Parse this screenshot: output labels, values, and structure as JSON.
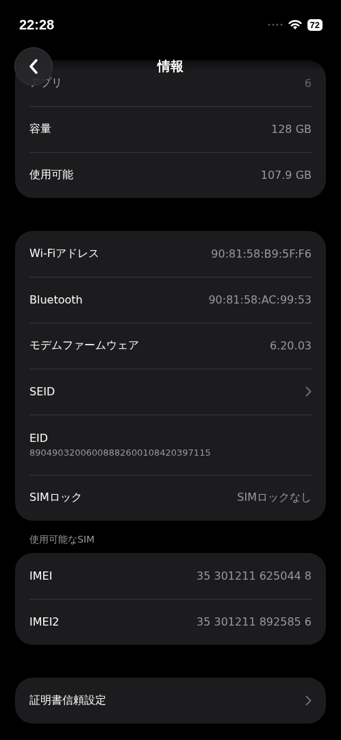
{
  "status_bar": {
    "time": "22:28",
    "battery": "72"
  },
  "nav": {
    "title": "情報"
  },
  "groups": [
    {
      "rows": [
        {
          "kind": "value",
          "label": "アプリ",
          "value": "6",
          "dimmed": true
        },
        {
          "kind": "value",
          "label": "容量",
          "value": "128 GB",
          "dimmed": false
        },
        {
          "kind": "value",
          "label": "使用可能",
          "value": "107.9 GB",
          "dimmed": false
        }
      ]
    },
    {
      "rows": [
        {
          "kind": "value",
          "label": "Wi-Fiアドレス",
          "value": "90:81:58:B9:5F:F6",
          "dimmed": false
        },
        {
          "kind": "value",
          "label": "Bluetooth",
          "value": "90:81:58:AC:99:53",
          "dimmed": false
        },
        {
          "kind": "value",
          "label": "モデムファームウェア",
          "value": "6.20.03",
          "dimmed": false
        },
        {
          "kind": "link",
          "label": "SEID",
          "dimmed": false
        },
        {
          "kind": "stacked",
          "label": "EID",
          "value": "89049032006008882600108420397115",
          "dimmed": false
        },
        {
          "kind": "value",
          "label": "SIMロック",
          "value": "SIMロックなし",
          "dimmed": false
        }
      ]
    },
    {
      "header": "使用可能なSIM",
      "rows": [
        {
          "kind": "value",
          "label": "IMEI",
          "value": "35 301211 625044 8",
          "dimmed": false
        },
        {
          "kind": "value",
          "label": "IMEI2",
          "value": "35 301211 892585 6",
          "dimmed": false
        }
      ]
    },
    {
      "rows": [
        {
          "kind": "link",
          "label": "証明書信頼設定",
          "dimmed": false
        }
      ]
    }
  ]
}
